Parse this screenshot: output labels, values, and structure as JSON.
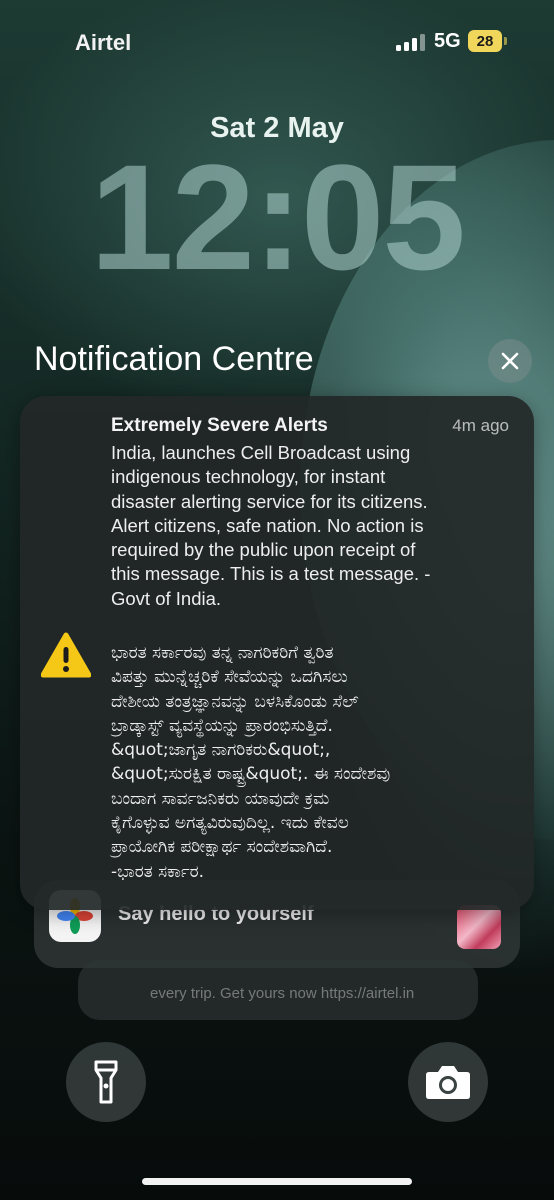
{
  "status_bar": {
    "carrier": "Airtel",
    "network": "5G",
    "battery": "28"
  },
  "lock_screen": {
    "date": "Sat 2 May",
    "time": "12:05"
  },
  "notification_centre": {
    "title": "Notification Centre"
  },
  "alert": {
    "title": "Extremely Severe Alerts",
    "time": "4m ago",
    "body_en": "India, launches Cell Broadcast using\nindigenous technology, for instant\ndisaster alerting service for its citizens.\nAlert citizens, safe nation. No action is\nrequired by the public upon receipt of\nthis message. This is a test message. -\nGovt of India.",
    "body_kn": "ಭಾರತ ಸರ್ಕಾರವು ತನ್ನ ನಾಗರಿಕರಿಗೆ ತ್ವರಿತ\nವಿಪತ್ತು ಮುನ್ನೆಚ್ಚರಿಕೆ ಸೇವೆಯನ್ನು ಒದಗಿಸಲು\nದೇಶೀಯ ತಂತ್ರಜ್ಞಾನವನ್ನು ಬಳಸಿಕೊಂಡು ಸೆಲ್\nಬ್ರಾಡ್ಕಾಸ್ಟ್ ವ್ಯವಸ್ಥೆಯನ್ನು ಪ್ರಾರಂಭಿಸುತ್ತಿದೆ.\n&quot;ಜಾಗೃತ ನಾಗರಿಕರು&quot;,\n&quot;ಸುರಕ್ಷಿತ ರಾಷ್ಟ್ರ&quot;. ಈ ಸಂದೇಶವು\nಬಂದಾಗ ಸಾರ್ವಜನಿಕರು ಯಾವುದೇ ಕ್ರಮ\nಕೈಗೊಳ್ಳುವ ಅಗತ್ಯವಿರುವುದಿಲ್ಲ. ಇದು ಕೇವಲ\nಪ್ರಾಯೋಗಿಕ ಪರೀಕ್ಷಾರ್ಥ ಸಂದೇಶವಾಗಿದೆ.\n-ಭಾರತ ಸರ್ಕಾರ.",
    "icon": "warning-icon"
  },
  "stacked": {
    "photos_text": "Say hello to yourself",
    "third_text": "every trip. Get yours now https://airtel.in"
  },
  "buttons": {
    "flashlight_icon": "flashlight-icon",
    "camera_icon": "camera-icon"
  }
}
